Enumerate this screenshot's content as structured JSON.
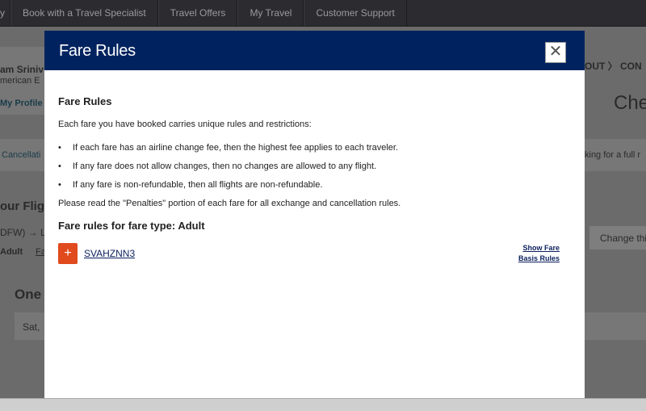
{
  "nav": {
    "items": [
      "y",
      "Book with a Travel Specialist",
      "Travel Offers",
      "My Travel",
      "Customer Support"
    ]
  },
  "background": {
    "user_name": "am Sriniv",
    "company": "merican E",
    "my_profile": "My Profile",
    "cancellation": "Cancellati",
    "your_flight": "our Flig",
    "route": "DFW) → L",
    "adult": "Adult",
    "fare_link": "Fa",
    "one": "One",
    "date": "Sat,",
    "steps": "OUT 〉 CON",
    "checkout": "Che",
    "looking": "king for a full r",
    "change_button": "Change thi"
  },
  "modal": {
    "title": "Fare Rules",
    "close_icon": "close-icon",
    "heading": "Fare Rules",
    "intro": "Each fare you have booked carries unique rules and restrictions:",
    "rules": [
      "If each fare has an airline change fee, then the highest fee applies to each traveler.",
      "If any fare does not allow changes, then no changes are allowed to any flight.",
      "If any fare is non-refundable, then all flights are non-refundable."
    ],
    "penalties_note": "Please read the \"Penalties\" portion of each fare for all exchange and cancellation rules.",
    "fare_type_heading": "Fare rules for fare type: Adult",
    "fare_code": "SVAHZNN3",
    "expand_label": "+",
    "show_rules_line1": "Show Fare",
    "show_rules_line2": "Basis Rules"
  },
  "colors": {
    "header": "#00235f",
    "expand": "#e04a1c",
    "link": "#0b1f5c"
  }
}
